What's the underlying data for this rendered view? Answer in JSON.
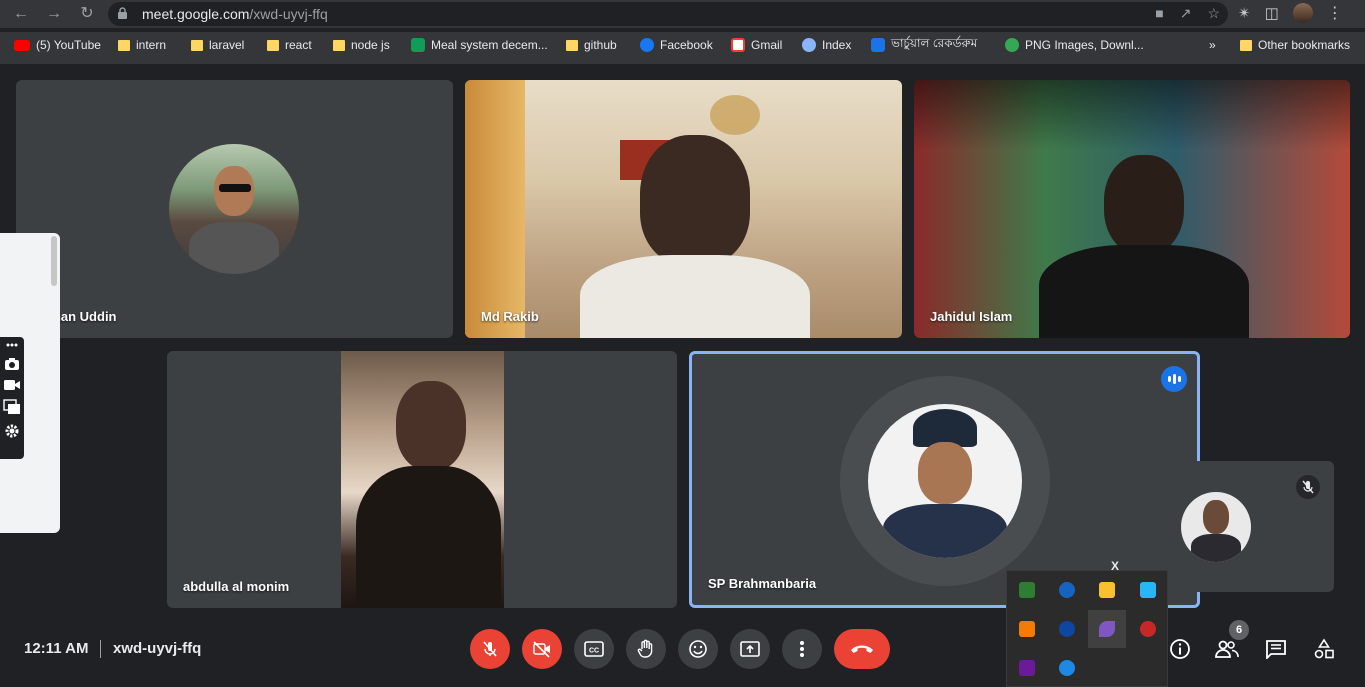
{
  "browser": {
    "url_host": "meet.google.com",
    "url_path": "/xwd-uyvj-ffq",
    "bookmarks": [
      {
        "label": "(5) YouTube",
        "icon": "youtube-icon"
      },
      {
        "label": "intern",
        "icon": "folder-icon"
      },
      {
        "label": "laravel",
        "icon": "folder-icon"
      },
      {
        "label": "react",
        "icon": "folder-icon"
      },
      {
        "label": "node js",
        "icon": "folder-icon"
      },
      {
        "label": "Meal system decem...",
        "icon": "sheets-icon"
      },
      {
        "label": "github",
        "icon": "folder-icon"
      },
      {
        "label": "Facebook",
        "icon": "facebook-icon"
      },
      {
        "label": "Gmail",
        "icon": "gmail-icon"
      },
      {
        "label": "Index",
        "icon": "index-icon"
      },
      {
        "label": "ভার্চুয়াল রেকর্ডরুম",
        "icon": "monitor-icon"
      },
      {
        "label": "PNG Images, Downl...",
        "icon": "pngimages-icon"
      }
    ],
    "bookmarks_overflow": "»",
    "other_bookmarks": "Other bookmarks"
  },
  "participants": [
    {
      "name": "Boman Uddin"
    },
    {
      "name": "Md Rakib"
    },
    {
      "name": "Jahidul Islam"
    },
    {
      "name": "abdulla al monim"
    },
    {
      "name": "SP Brahmanbaria"
    }
  ],
  "self_tile": {
    "close_label": "X"
  },
  "meeting": {
    "time": "12:11 AM",
    "code": "xwd-uyvj-ffq",
    "people_count": "6"
  },
  "colors": {
    "end_call": "#ea4335",
    "speaking": "#8ab4f8",
    "background": "#202124",
    "tile": "#3c4043"
  }
}
